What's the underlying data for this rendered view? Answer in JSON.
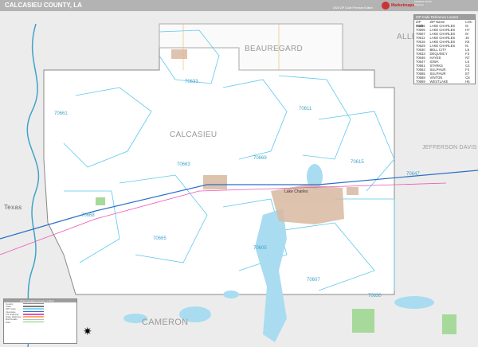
{
  "header": {
    "title": "CALCASIEU COUNTY, LA",
    "edition": "2020 ZIP Code Premium Edition",
    "logo": "Marketmaps",
    "logo_side": "MARKET MAPS Premium"
  },
  "map": {
    "parishes": [
      "BEAUREGARD",
      "ALLEN",
      "CALCASIEU",
      "JEFFERSON DAVIS",
      "CAMERON"
    ],
    "state": "Texas",
    "city": "Lake Charles",
    "zips": [
      {
        "code": "70633"
      },
      {
        "code": "70661"
      },
      {
        "code": "70611"
      },
      {
        "code": "70669"
      },
      {
        "code": "70663"
      },
      {
        "code": "70615"
      },
      {
        "code": "70647"
      },
      {
        "code": "70665"
      },
      {
        "code": "70605"
      },
      {
        "code": "70607"
      },
      {
        "code": "70630"
      },
      {
        "code": "70668"
      }
    ]
  },
  "zip_table": {
    "title": "ZIP Code Reference Locator",
    "headers": [
      "ZIP Code",
      "ZIP Name",
      "LOC"
    ],
    "rows": [
      [
        "70601",
        "LAKE CHARLES",
        "I6"
      ],
      [
        "70605",
        "LAKE CHARLES",
        "H7"
      ],
      [
        "70607",
        "LAKE CHARLES",
        "I8"
      ],
      [
        "70611",
        "LAKE CHARLES",
        "J5"
      ],
      [
        "70615",
        "LAKE CHARLES",
        "K5"
      ],
      [
        "70629",
        "LAKE CHARLES",
        "I5"
      ],
      [
        "70630",
        "BELL CITY",
        "L8"
      ],
      [
        "70633",
        "DEQUINCY",
        "F2"
      ],
      [
        "70646",
        "HAYES",
        "N7"
      ],
      [
        "70647",
        "IOWA",
        "L5"
      ],
      [
        "70661",
        "STARKS",
        "C4"
      ],
      [
        "70663",
        "SULPHUR",
        "F4"
      ],
      [
        "70665",
        "SULPHUR",
        "E7"
      ],
      [
        "70668",
        "VINTON",
        "C8"
      ],
      [
        "70669",
        "WESTLAKE",
        "H5"
      ]
    ]
  },
  "legend": {
    "title": "2020 Calcasieu County, LA Map",
    "items": [
      {
        "label": "County",
        "color": "#888888"
      },
      {
        "label": "State",
        "color": "#777777"
      },
      {
        "label": "ZIP Code",
        "color": "#7fd8f0"
      },
      {
        "label": "Interstate",
        "color": "#2b6fc9"
      },
      {
        "label": "US Highway",
        "color": "#ee4fb5"
      },
      {
        "label": "State Highway",
        "color": "#f2b26b"
      },
      {
        "label": "Rail Roads",
        "color": "#bbbbbb"
      },
      {
        "label": "Park",
        "color": "#7ccf6e"
      }
    ]
  },
  "colors": {
    "water": "#a9dcf0",
    "urban": "#d8b9a0",
    "zip_line": "#5cc8ee",
    "county": "#9a9a9a",
    "outside": "#ececec"
  }
}
